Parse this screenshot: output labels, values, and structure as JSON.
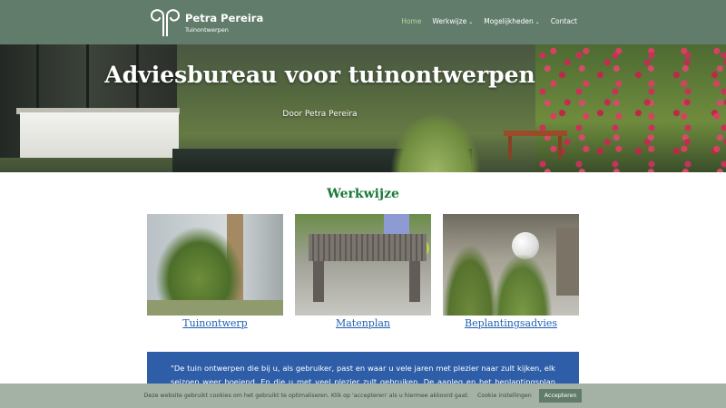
{
  "site": {
    "name": "Petra Pereira",
    "tagline": "Tuinontwerpen"
  },
  "nav": {
    "items": [
      {
        "label": "Home",
        "active": true,
        "dropdown": false
      },
      {
        "label": "Werkwijze",
        "active": false,
        "dropdown": true
      },
      {
        "label": "Mogelijkheden",
        "active": false,
        "dropdown": true
      },
      {
        "label": "Contact",
        "active": false,
        "dropdown": false
      }
    ],
    "caret": "⌄"
  },
  "hero": {
    "title": "Adviesbureau voor tuinontwerpen",
    "subtitle": "Door Petra Pereira"
  },
  "section": {
    "title": "Werkwijze",
    "cards": [
      {
        "label": "Tuinontwerp"
      },
      {
        "label": "Matenplan"
      },
      {
        "label": "Beplantingsadvies"
      }
    ]
  },
  "quote": {
    "text": "\"De tuin ontwerpen die bij u, als gebruiker, past en waar u vele jaren met plezier naar zult kijken, elk seizoen weer boeiend. En die u met veel plezier zult gebruiken. De aanleg en het beplantingsplan kunt u eventueel aan de hand"
  },
  "cookie": {
    "message": "Deze website gebruikt cookies om het gebruikt te optimaliseren. Klik op 'accepteren' als u hiermee akkoord gaat.",
    "settings_label": "Cookie instellingen",
    "accept_label": "Accepteren"
  },
  "colors": {
    "header": "#627c6c",
    "nav_active": "#b7d39f",
    "section_title": "#1a7a3a",
    "link": "#1f5fb0",
    "quote_bg": "#2f5ea8",
    "cookie_bg": "#a3b2a5"
  }
}
